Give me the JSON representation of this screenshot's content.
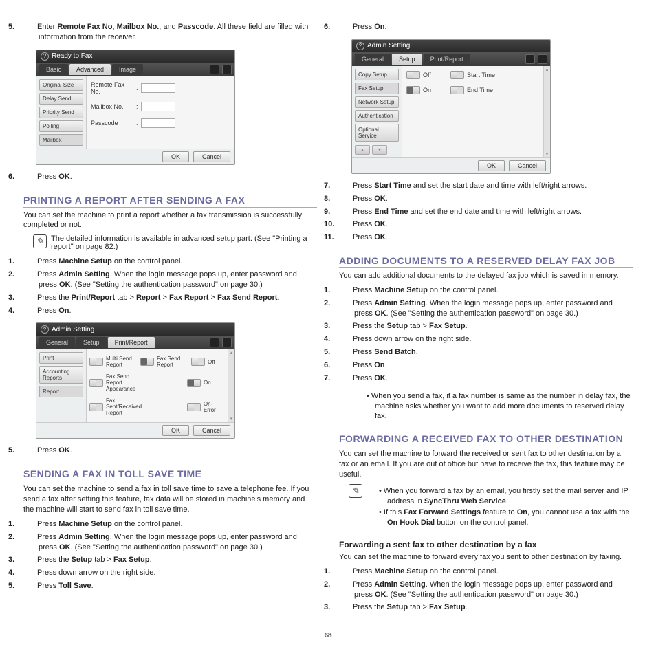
{
  "pagenum": "68",
  "left": {
    "step5_intro": {
      "num": "5.",
      "pre": "Enter ",
      "b1": "Remote Fax No",
      "comma": ", ",
      "b2": "Mailbox No.",
      "and": ", and ",
      "b3": "Passcode",
      "post": ". All these field are filled with information from the receiver."
    },
    "shot1": {
      "title": "Ready to Fax",
      "tabs": [
        "Basic",
        "Advanced",
        "Image"
      ],
      "side": [
        "Original Size",
        "Delay Send",
        "Priority Send",
        "Polling",
        "Mailbox"
      ],
      "fields": [
        "Remote Fax No.",
        "Mailbox No.",
        "Passcode"
      ],
      "ok": "OK",
      "cancel": "Cancel"
    },
    "step6": {
      "num": "6.",
      "pre": "Press ",
      "b": "OK",
      "post": "."
    },
    "h_print": "PRINTING A REPORT AFTER SENDING A FAX",
    "print_intro": "You can set the machine to print a report whether a fax transmission is successfully completed or not.",
    "print_note": "The detailed information is available in advanced setup part. (See \"Printing a report\" on page 82.)",
    "print_steps": [
      {
        "num": "1.",
        "parts": [
          {
            "t": "Press "
          },
          {
            "b": "Machine Setup"
          },
          {
            "t": " on the control panel."
          }
        ]
      },
      {
        "num": "2.",
        "parts": [
          {
            "t": "Press "
          },
          {
            "b": "Admin Setting"
          },
          {
            "t": ". When the login message pops up, enter password and press "
          },
          {
            "b": "OK"
          },
          {
            "t": ". (See \"Setting the authentication password\" on page 30.)"
          }
        ]
      },
      {
        "num": "3.",
        "parts": [
          {
            "t": "Press the "
          },
          {
            "b": "Print/Report"
          },
          {
            "t": " tab > "
          },
          {
            "b": "Report"
          },
          {
            "t": " > "
          },
          {
            "b": "Fax Report"
          },
          {
            "t": " > "
          },
          {
            "b": "Fax Send Report"
          },
          {
            "t": "."
          }
        ]
      },
      {
        "num": "4.",
        "parts": [
          {
            "t": "Press "
          },
          {
            "b": "On"
          },
          {
            "t": "."
          }
        ]
      }
    ],
    "shot2": {
      "title": "Admin Setting",
      "tabs": [
        "General",
        "Setup",
        "Print/Report"
      ],
      "side": [
        "Print",
        "Accounting Reports",
        "Report"
      ],
      "items": [
        [
          "Multi Send Report",
          "Fax Send Report",
          "Off"
        ],
        [
          "Fax Send Report Appearance",
          "",
          "On"
        ],
        [
          "Fax Sent/Received Report",
          "",
          "On-Error"
        ]
      ],
      "ok": "OK",
      "cancel": "Cancel"
    },
    "print_step5": {
      "num": "5.",
      "pre": "Press ",
      "b": "OK",
      "post": "."
    },
    "h_toll": "SENDING A FAX IN TOLL SAVE TIME",
    "toll_intro": "You can set the machine to send a fax in toll save time to save a telephone fee. If you send a fax after setting this feature, fax data will be stored in machine's memory and the machine will start to send fax in toll save time.",
    "toll_steps": [
      {
        "num": "1.",
        "parts": [
          {
            "t": "Press "
          },
          {
            "b": "Machine Setup"
          },
          {
            "t": " on the control panel."
          }
        ]
      },
      {
        "num": "2.",
        "parts": [
          {
            "t": "Press "
          },
          {
            "b": "Admin Setting"
          },
          {
            "t": ". When the login message pops up, enter password and press "
          },
          {
            "b": "OK"
          },
          {
            "t": ". (See \"Setting the authentication password\" on page 30.)"
          }
        ]
      },
      {
        "num": "3.",
        "parts": [
          {
            "t": "Press the "
          },
          {
            "b": "Setup"
          },
          {
            "t": " tab > "
          },
          {
            "b": "Fax Setup"
          },
          {
            "t": "."
          }
        ]
      },
      {
        "num": "4.",
        "parts": [
          {
            "t": "Press down arrow on the right side."
          }
        ]
      },
      {
        "num": "5.",
        "parts": [
          {
            "t": "Press "
          },
          {
            "b": "Toll Save"
          },
          {
            "t": "."
          }
        ]
      }
    ]
  },
  "right": {
    "step6r": {
      "num": "6.",
      "pre": "Press ",
      "b": "On",
      "post": "."
    },
    "shot3": {
      "title": "Admin Setting",
      "tabs": [
        "General",
        "Setup",
        "Print/Report"
      ],
      "side": [
        "Copy Setup",
        "Fax Setup",
        "Network Setup",
        "Authentication",
        "Optional Service"
      ],
      "rows": [
        [
          "Off",
          "Start Time"
        ],
        [
          "On",
          "End Time"
        ]
      ],
      "ok": "OK",
      "cancel": "Cancel"
    },
    "cont_steps": [
      {
        "num": "7.",
        "parts": [
          {
            "t": "Press "
          },
          {
            "b": "Start Time"
          },
          {
            "t": " and set the start date and time with left/right arrows."
          }
        ]
      },
      {
        "num": "8.",
        "parts": [
          {
            "t": "Press "
          },
          {
            "b": "OK"
          },
          {
            "t": "."
          }
        ]
      },
      {
        "num": "9.",
        "parts": [
          {
            "t": "Press "
          },
          {
            "b": "End Time"
          },
          {
            "t": " and set the end date and time with left/right arrows."
          }
        ]
      },
      {
        "num": "10.",
        "parts": [
          {
            "t": "Press "
          },
          {
            "b": "OK"
          },
          {
            "t": "."
          }
        ]
      },
      {
        "num": "11.",
        "parts": [
          {
            "t": "Press "
          },
          {
            "b": "OK"
          },
          {
            "t": "."
          }
        ]
      }
    ],
    "h_add": "ADDING DOCUMENTS TO A RESERVED DELAY FAX JOB",
    "add_intro": "You can add additional documents to the delayed fax job which is saved in memory.",
    "add_steps": [
      {
        "num": "1.",
        "parts": [
          {
            "t": "Press "
          },
          {
            "b": "Machine Setup"
          },
          {
            "t": " on the control panel."
          }
        ]
      },
      {
        "num": "2.",
        "parts": [
          {
            "t": "Press "
          },
          {
            "b": "Admin Setting"
          },
          {
            "t": ". When the login message pops up, enter password and press "
          },
          {
            "b": "OK"
          },
          {
            "t": ". (See \"Setting the authentication password\" on page 30.)"
          }
        ]
      },
      {
        "num": "3.",
        "parts": [
          {
            "t": "Press the "
          },
          {
            "b": "Setup"
          },
          {
            "t": " tab > "
          },
          {
            "b": "Fax Setup"
          },
          {
            "t": "."
          }
        ]
      },
      {
        "num": "4.",
        "parts": [
          {
            "t": "Press down arrow on the right side."
          }
        ]
      },
      {
        "num": "5.",
        "parts": [
          {
            "t": "Press "
          },
          {
            "b": "Send Batch"
          },
          {
            "t": "."
          }
        ]
      },
      {
        "num": "6.",
        "parts": [
          {
            "t": "Press "
          },
          {
            "b": "On"
          },
          {
            "t": "."
          }
        ]
      },
      {
        "num": "7.",
        "parts": [
          {
            "t": "Press "
          },
          {
            "b": "OK"
          },
          {
            "t": "."
          }
        ]
      }
    ],
    "add_bullet": "When you send a fax, if a fax number is same as the number in delay fax, the machine asks whether you want to add more documents to reserved delay fax.",
    "h_fwd": "FORWARDING A RECEIVED FAX TO OTHER DESTINATION",
    "fwd_intro": "You can set the machine to forward the received or sent fax to other destination by a fax or an email. If you are out of office but have to receive the fax, this feature may be useful.",
    "fwd_note": [
      [
        {
          "t": "When you forward a fax by an email, you firstly set the mail server and IP address in "
        },
        {
          "b": "SyncThru Web Service"
        },
        {
          "t": "."
        }
      ],
      [
        {
          "t": "If this "
        },
        {
          "b": "Fax Forward Settings"
        },
        {
          "t": " feature to "
        },
        {
          "b": "On"
        },
        {
          "t": ", you cannot use a fax with the "
        },
        {
          "b": "On Hook Dial"
        },
        {
          "t": " button on the control panel."
        }
      ]
    ],
    "h_sub": "Forwarding a sent fax to other destination by a fax",
    "sub_intro": "You can set the machine to forward every fax you sent to other destination by faxing.",
    "sub_steps": [
      {
        "num": "1.",
        "parts": [
          {
            "t": "Press "
          },
          {
            "b": "Machine Setup"
          },
          {
            "t": " on the control panel."
          }
        ]
      },
      {
        "num": "2.",
        "parts": [
          {
            "t": "Press "
          },
          {
            "b": "Admin Setting"
          },
          {
            "t": ". When the login message pops up, enter password and press "
          },
          {
            "b": "OK"
          },
          {
            "t": ". (See \"Setting the authentication password\" on page 30.)"
          }
        ]
      },
      {
        "num": "3.",
        "parts": [
          {
            "t": "Press the "
          },
          {
            "b": "Setup"
          },
          {
            "t": " tab > "
          },
          {
            "b": "Fax Setup"
          },
          {
            "t": "."
          }
        ]
      }
    ]
  }
}
